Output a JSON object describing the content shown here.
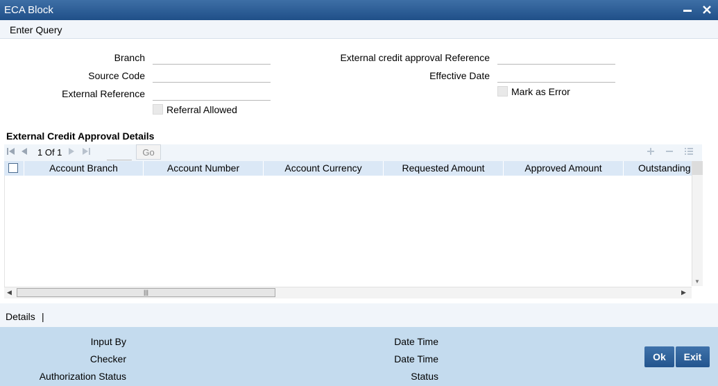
{
  "window": {
    "title": "ECA Block",
    "minimize_glyph": "▬",
    "close_glyph": "✕"
  },
  "menu": {
    "enter_query": "Enter Query"
  },
  "form": {
    "branch_label": "Branch",
    "source_code_label": "Source Code",
    "external_reference_label": "External Reference",
    "referral_allowed_label": "Referral Allowed",
    "eca_reference_label": "External credit approval Reference",
    "effective_date_label": "Effective Date",
    "mark_as_error_label": "Mark as Error"
  },
  "section": {
    "title": "External Credit Approval Details"
  },
  "grid": {
    "pager_text": "1 Of 1",
    "go_label": "Go",
    "columns": [
      "Account Branch",
      "Account Number",
      "Account Currency",
      "Requested Amount",
      "Approved Amount",
      "Outstanding"
    ],
    "rows": []
  },
  "details": {
    "link_label": "Details",
    "separator": "|"
  },
  "footer": {
    "input_by_label": "Input By",
    "checker_label": "Checker",
    "authorization_status_label": "Authorization Status",
    "date_time_label_1": "Date Time",
    "date_time_label_2": "Date Time",
    "status_label": "Status",
    "ok_label": "Ok",
    "exit_label": "Exit"
  },
  "colors": {
    "titlebar": "#2b5d97",
    "footer": "#c4dbee",
    "grid_header": "#dbe8f6",
    "button": "#2f64a0"
  }
}
